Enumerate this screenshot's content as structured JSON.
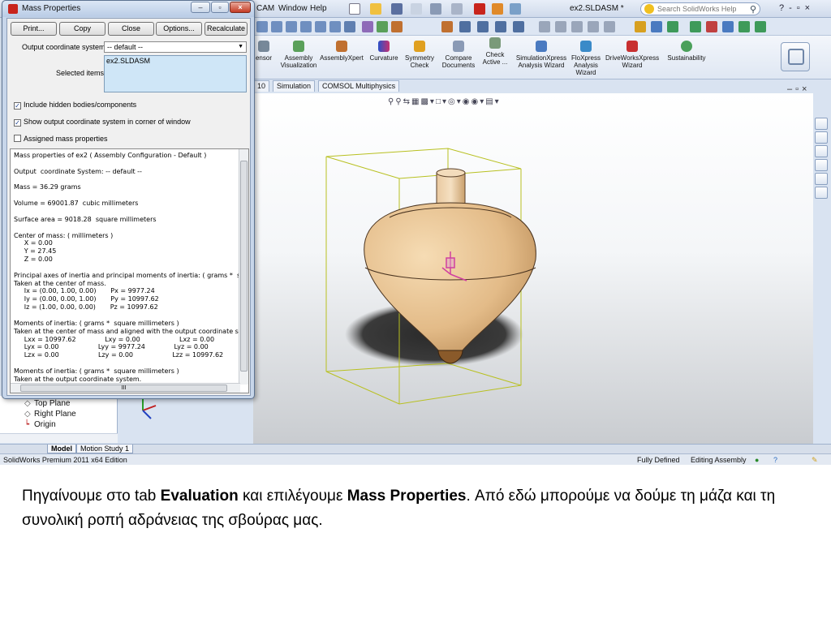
{
  "app": {
    "menus": [
      "CAM",
      "Window",
      "Help"
    ],
    "document_title": "ex2.SLDASM *",
    "help_search_placeholder": "Search SolidWorks Help",
    "ribbon_items": [
      {
        "label": "ensor"
      },
      {
        "label": "Assembly Visualization"
      },
      {
        "label": "AssemblyXpert"
      },
      {
        "label": "Curvature"
      },
      {
        "label": "Symmetry Check"
      },
      {
        "label": "Compare Documents"
      },
      {
        "label": "Check Active ..."
      },
      {
        "label": "SimulationXpress Analysis Wizard"
      },
      {
        "label": "FloXpress Analysis Wizard"
      },
      {
        "label": "DriveWorksXpress Wizard"
      },
      {
        "label": "Sustainability"
      }
    ],
    "command_tabs": [
      "10",
      "Simulation",
      "COMSOL Multiphysics"
    ],
    "tree_items": [
      "Top Plane",
      "Right Plane",
      "Origin"
    ],
    "bottom_tabs": [
      "Model",
      "Motion Study 1"
    ],
    "status": {
      "edition": "SolidWorks Premium 2011 x64 Edition",
      "state": "Fully Defined",
      "mode": "Editing Assembly"
    },
    "colors": {
      "accent": "#c8241c",
      "ribbon": "#dfe7f3",
      "part": "#e7c597"
    }
  },
  "dialog": {
    "title": "Mass Properties",
    "buttons": [
      "Print...",
      "Copy",
      "Close",
      "Options...",
      "Recalculate"
    ],
    "output_coord_label": "Output coordinate system:",
    "output_coord_value": "-- default --",
    "selected_items_label": "Selected items:",
    "selected_items_value": "ex2.SLDASM",
    "checkboxes": [
      {
        "label": "Include hidden bodies/components",
        "checked": true
      },
      {
        "label": "Show output coordinate system in corner of window",
        "checked": true
      },
      {
        "label": "Assigned mass properties",
        "checked": false
      }
    ],
    "results": [
      "Mass properties of ex2 ( Assembly Configuration - Default )",
      "",
      "Output  coordinate System: -- default --",
      "",
      "Mass = 36.29 grams",
      "",
      "Volume = 69001.87  cubic millimeters",
      "",
      "Surface area = 9018.28  square millimeters",
      "",
      "Center of mass: ( millimeters )",
      "     X = 0.00",
      "     Y = 27.45",
      "     Z = 0.00",
      "",
      "Principal axes of inertia and principal moments of inertia: ( grams *  square mill",
      "Taken at the center of mass.",
      "     Ix = (0.00, 1.00, 0.00)       Px = 9977.24",
      "     Iy = (0.00, 0.00, 1.00)       Py = 10997.62",
      "     Iz = (1.00, 0.00, 0.00)       Pz = 10997.62",
      "",
      "Moments of inertia: ( grams *  square millimeters )",
      "Taken at the center of mass and aligned with the output coordinate system.",
      "     Lxx = 10997.62              Lxy = 0.00                   Lxz = 0.00",
      "     Lyx = 0.00                   Lyy = 9977.24              Lyz = 0.00",
      "     Lzx = 0.00                   Lzy = 0.00                   Lzz = 10997.62",
      "",
      "Moments of inertia: ( grams *  square millimeters )",
      "Taken at the output coordinate system."
    ],
    "scroll_glyph": "III"
  },
  "caption": {
    "intro": "Πηγαίνουμε στο tab ",
    "tab_name": "Evaluation",
    "middle": " και επιλέγουμε ",
    "command": "Mass Properties",
    "rest": ". Από εδώ μπορούμε να δούμε τη μάζα και τη συνολική ροπή αδράνειας της σβούρας μας."
  }
}
